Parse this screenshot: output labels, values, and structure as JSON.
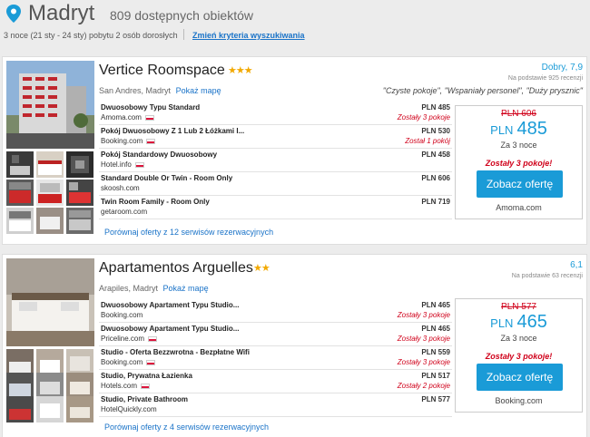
{
  "search": {
    "city": "Madryt",
    "count": "809 dostępnych obiektów",
    "criteria": "3 noce (21 sty - 24 sty) pobytu 2 osób dorosłych",
    "change_link": "Zmień kryteria wyszukiwania"
  },
  "hotels": [
    {
      "name": "Vertice Roomspace",
      "stars": "★★★",
      "address": "San Andres, Madryt",
      "map_link": "Pokaż mapę",
      "rating": "Dobry, 7,9",
      "reviews": "Na podstawie 925 recenzji",
      "quotes": "\"Czyste pokoje\", \"Wspaniały personel\", \"Duży prysznic\"",
      "offers": [
        {
          "room": "Dwuosobowy Typu Standard",
          "site": "Amoma.com",
          "price": "PLN 485",
          "note": "Zostały 3 pokoje"
        },
        {
          "room": "Pokój Dwuosobowy Z 1 Lub 2 Łóżkami I...",
          "site": "Booking.com",
          "price": "PLN 530",
          "note": "Został 1 pokój"
        },
        {
          "room": "Pokój Standardowy Dwuosobowy",
          "site": "Hotel.info",
          "price": "PLN 458",
          "note": ""
        },
        {
          "room": "Standard Double Or Twin - Room Only",
          "site": "skoosh.com",
          "price": "PLN 606",
          "note": ""
        },
        {
          "room": "Twin Room Family - Room Only",
          "site": "getaroom.com",
          "price": "PLN 719",
          "note": ""
        }
      ],
      "more": "Porównaj oferty z 12 serwisów rezerwacyjnych",
      "price_old": "PLN 606",
      "price_currency": "PLN",
      "price_value": "485",
      "nights": "Za 3 noce",
      "rooms_left": "Zostały 3 pokoje!",
      "cta": "Zobacz ofertę",
      "provider": "Amoma.com"
    },
    {
      "name": "Apartamentos Arguelles",
      "stars": "★★",
      "address": "Arapiles, Madryt",
      "map_link": "Pokaż mapę",
      "rating": "6,1",
      "reviews": "Na podstawie 63 recenzji",
      "quotes": "",
      "offers": [
        {
          "room": "Dwuosobowy Apartament Typu Studio...",
          "site": "Booking.com",
          "price": "PLN 465",
          "note": "Zostały 3 pokoje"
        },
        {
          "room": "Dwuosobowy Apartament Typu Studio...",
          "site": "Priceline.com",
          "price": "PLN 465",
          "note": "Zostały 3 pokoje"
        },
        {
          "room": "Studio - Oferta Bezzwrotna - Bezpłatne Wifi",
          "site": "Booking.com",
          "price": "PLN 559",
          "note": "Zostały 3 pokoje"
        },
        {
          "room": "Studio, Prywatna Łazienka",
          "site": "Hotels.com",
          "price": "PLN 517",
          "note": "Zostały 2 pokoje"
        },
        {
          "room": "Studio, Private Bathroom",
          "site": "HotelQuickly.com",
          "price": "PLN 577",
          "note": ""
        }
      ],
      "more": "Porównaj oferty z 4 serwisów rezerwacyjnych",
      "price_old": "PLN 577",
      "price_currency": "PLN",
      "price_value": "465",
      "nights": "Za 3 noce",
      "rooms_left": "Zostały 3 pokoje!",
      "cta": "Zobacz ofertę",
      "provider": "Booking.com"
    }
  ],
  "colors": {
    "accent": "#1a9bd7",
    "link": "#1a73c8",
    "alert": "#d0021b",
    "stars": "#f2a900"
  },
  "icons": [
    "location-pin-icon",
    "flag-icon",
    "star-icon"
  ]
}
